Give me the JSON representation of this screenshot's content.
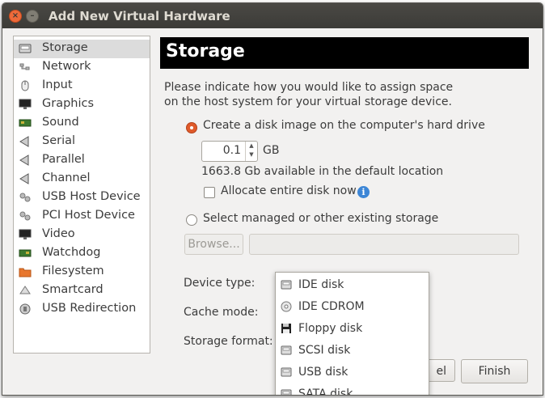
{
  "window": {
    "title": "Add New Virtual Hardware"
  },
  "sidebar": {
    "items": [
      {
        "label": "Storage",
        "icon": "storage-icon"
      },
      {
        "label": "Network",
        "icon": "network-icon"
      },
      {
        "label": "Input",
        "icon": "mouse-icon"
      },
      {
        "label": "Graphics",
        "icon": "monitor-icon"
      },
      {
        "label": "Sound",
        "icon": "sound-card-icon"
      },
      {
        "label": "Serial",
        "icon": "serial-port-icon"
      },
      {
        "label": "Parallel",
        "icon": "parallel-port-icon"
      },
      {
        "label": "Channel",
        "icon": "channel-icon"
      },
      {
        "label": "USB Host Device",
        "icon": "usb-host-icon"
      },
      {
        "label": "PCI Host Device",
        "icon": "pci-host-icon"
      },
      {
        "label": "Video",
        "icon": "video-icon"
      },
      {
        "label": "Watchdog",
        "icon": "watchdog-icon"
      },
      {
        "label": "Filesystem",
        "icon": "folder-icon"
      },
      {
        "label": "Smartcard",
        "icon": "smartcard-icon"
      },
      {
        "label": "USB Redirection",
        "icon": "usb-redirection-icon"
      }
    ],
    "selected": "Storage"
  },
  "main": {
    "header_title": "Storage",
    "desc_line1": "Please indicate how you would like to assign space",
    "desc_line2": "on the host system for your virtual storage device.",
    "option_create": "Create a disk image on the computer's hard drive",
    "size_value": "0.1",
    "size_unit": "GB",
    "available": "1663.8 Gb available in the default location",
    "allocate_label": "Allocate entire disk now",
    "option_existing": "Select managed or other existing storage",
    "browse_label": "Browse...",
    "device_type_label": "Device type:",
    "cache_mode_label": "Cache mode:",
    "storage_format_label": "Storage format:"
  },
  "dropdown": {
    "items": [
      {
        "label": "IDE disk",
        "icon": "hard-disk-icon"
      },
      {
        "label": "IDE CDROM",
        "icon": "cdrom-icon"
      },
      {
        "label": "Floppy disk",
        "icon": "floppy-icon"
      },
      {
        "label": "SCSI disk",
        "icon": "hard-disk-icon"
      },
      {
        "label": "USB disk",
        "icon": "hard-disk-icon"
      },
      {
        "label": "SATA disk",
        "icon": "hard-disk-icon"
      }
    ]
  },
  "buttons": {
    "cancel_fragment": "el",
    "finish": "Finish"
  },
  "colors": {
    "accent": "#e05a2a",
    "header_bg": "#000000",
    "info": "#3d86d6"
  }
}
